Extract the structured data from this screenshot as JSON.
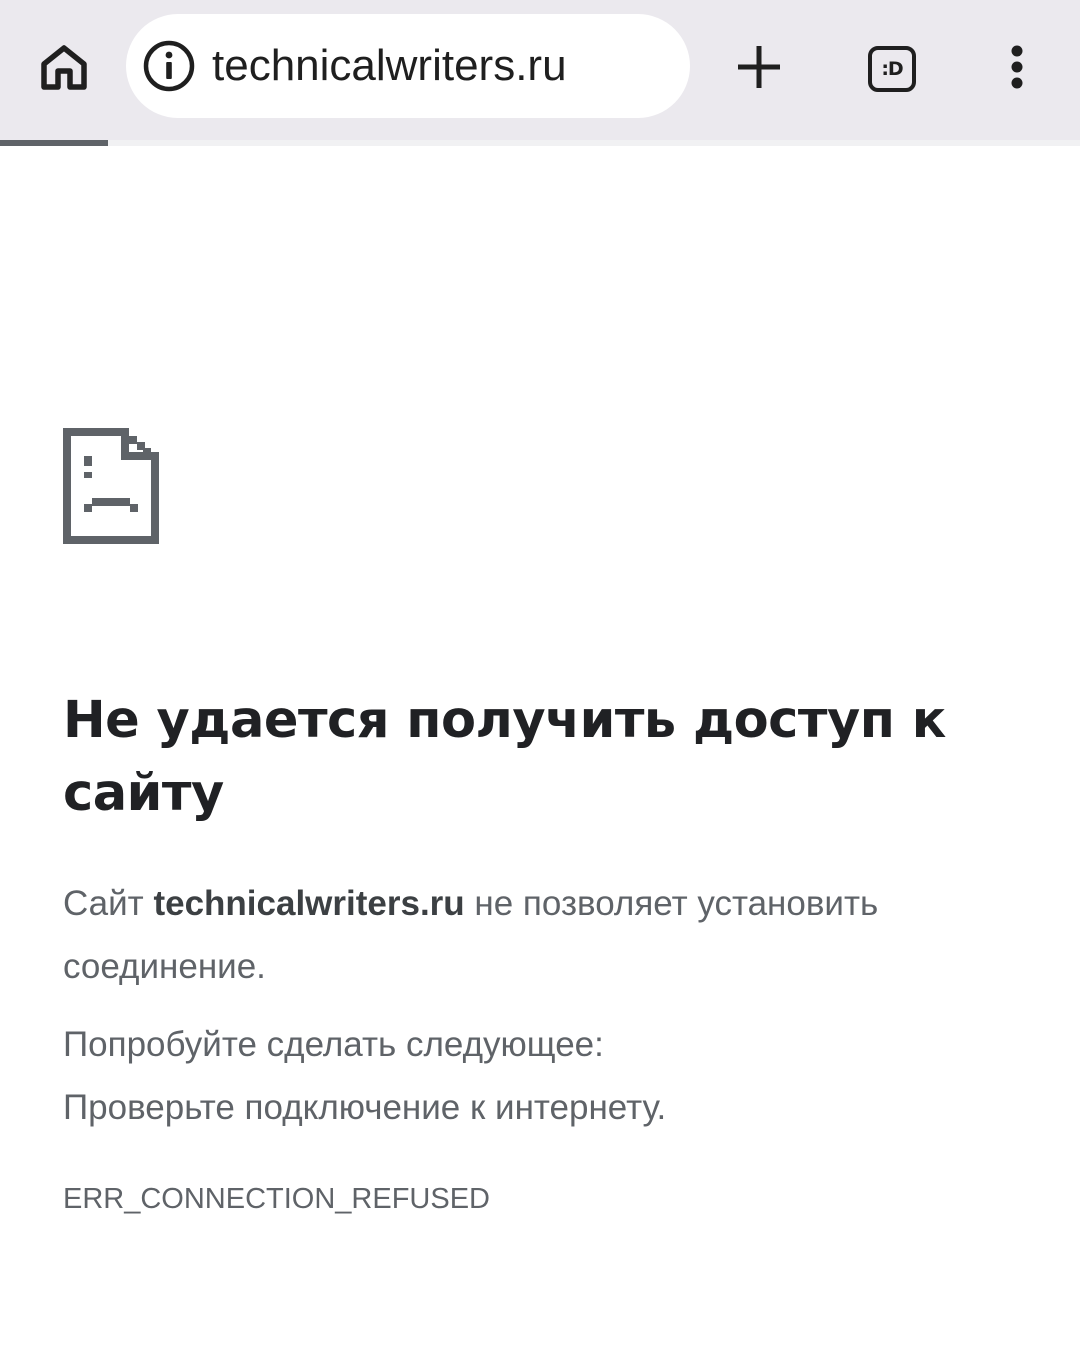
{
  "toolbar": {
    "url": "technicalwriters.ru",
    "tabs_icon_text": ":D",
    "load_progress": 0.1
  },
  "error": {
    "title": "Не удается получить доступ к сайту",
    "desc_prefix": "Сайт ",
    "desc_host": "technicalwriters.ru",
    "desc_suffix": " не позволяет установить соединение.",
    "suggest_heading": "Попробуйте сделать следующее:",
    "suggestions": [
      "Проверьте подключение к интернету."
    ],
    "code": "ERR_CONNECTION_REFUSED"
  },
  "icons": {
    "home": "home-icon",
    "info": "info-icon",
    "new_tab": "plus-icon",
    "tabs": "tab-switcher-icon",
    "menu": "more-vert-icon",
    "error": "sad-page-icon"
  },
  "colors": {
    "toolbar_bg": "#ebe9ee",
    "title": "#202124",
    "body_text": "#5f6368",
    "progress": "#5f6368"
  }
}
